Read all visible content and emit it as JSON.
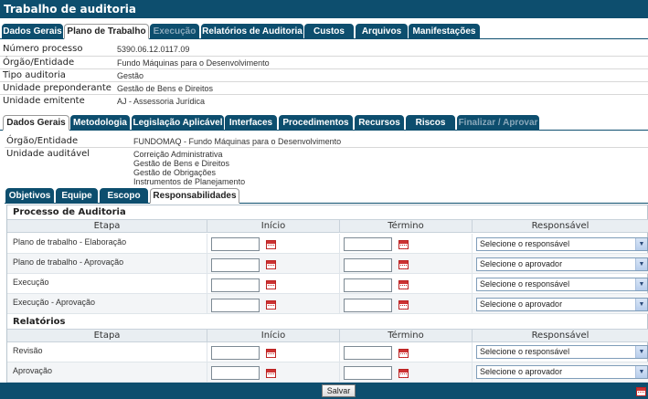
{
  "app": {
    "title": "Trabalho de auditoria"
  },
  "main_tabs": [
    {
      "label": "Dados Gerais",
      "state": "normal"
    },
    {
      "label": "Plano de Trabalho",
      "state": "active"
    },
    {
      "label": "Execução",
      "state": "muted"
    },
    {
      "label": "Relatórios de Auditoria",
      "state": "normal"
    },
    {
      "label": "Custos",
      "state": "normal"
    },
    {
      "label": "Arquivos",
      "state": "normal"
    },
    {
      "label": "Manifestações",
      "state": "normal"
    }
  ],
  "summary": [
    {
      "label": "Número processo",
      "value": "5390.06.12.0117.09"
    },
    {
      "label": "Órgão/Entidade",
      "value": "Fundo Máquinas para o Desenvolvimento"
    },
    {
      "label": "Tipo auditoria",
      "value": "Gestão"
    },
    {
      "label": "Unidade preponderante",
      "value": "Gestão de Bens e Direitos"
    },
    {
      "label": "Unidade emitente",
      "value": "AJ - Assessoria Jurídica"
    }
  ],
  "sub_tabs": [
    {
      "label": "Dados Gerais",
      "state": "active"
    },
    {
      "label": "Metodologia",
      "state": "normal"
    },
    {
      "label": "Legislação Aplicável",
      "state": "normal"
    },
    {
      "label": "Interfaces",
      "state": "normal"
    },
    {
      "label": "Procedimentos",
      "state": "normal"
    },
    {
      "label": "Recursos",
      "state": "normal"
    },
    {
      "label": "Riscos",
      "state": "normal"
    },
    {
      "label": "Finalizar / Aprovar",
      "state": "muted"
    }
  ],
  "details": {
    "org_label": "Órgão/Entidade",
    "org_value": "FUNDOMAQ - Fundo Máquinas para o Desenvolvimento",
    "unit_label": "Unidade auditável",
    "units": [
      "Correição Administrativa",
      "Gestão de Bens e Direitos",
      "Gestão de Obrigações",
      "Instrumentos de Planejamento"
    ]
  },
  "inner_tabs": [
    {
      "label": "Objetivos",
      "state": "normal"
    },
    {
      "label": "Equipe",
      "state": "normal"
    },
    {
      "label": "Escopo",
      "state": "normal"
    },
    {
      "label": "Responsabilidades",
      "state": "active"
    }
  ],
  "columns": {
    "etapa": "Etapa",
    "inicio": "Início",
    "termino": "Término",
    "responsavel": "Responsável"
  },
  "section_audit": {
    "title": "Processo de Auditoria",
    "rows": [
      {
        "etapa": "Plano de trabalho - Elaboração",
        "select": "Selecione o responsável"
      },
      {
        "etapa": "Plano de trabalho - Aprovação",
        "select": "Selecione o aprovador"
      },
      {
        "etapa": "Execução",
        "select": "Selecione o responsável"
      },
      {
        "etapa": "Execução - Aprovação",
        "select": "Selecione o aprovador"
      }
    ]
  },
  "section_reports": {
    "title": "Relatórios",
    "rows": [
      {
        "etapa": "Revisão",
        "select": "Selecione o responsável"
      },
      {
        "etapa": "Aprovação",
        "select": "Selecione o aprovador"
      }
    ]
  },
  "footer": {
    "save_label": "Salvar"
  },
  "colors": {
    "brand": "#0d4e6e",
    "header_bg": "#e9eef2"
  }
}
